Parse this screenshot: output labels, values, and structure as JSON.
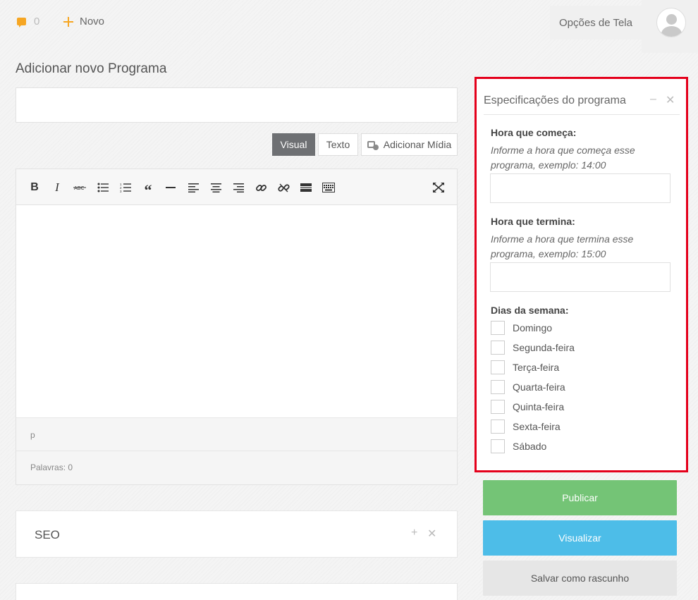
{
  "topbar": {
    "comment_count": "0",
    "new_label": "Novo",
    "screen_options_label": "Opções de Tela"
  },
  "page": {
    "title": "Adicionar novo Programa"
  },
  "editor": {
    "tab_visual": "Visual",
    "tab_text": "Texto",
    "add_media_label": "Adicionar Mídia",
    "path_label": "p",
    "word_count_label": "Palavras: 0"
  },
  "seo": {
    "title": "SEO"
  },
  "spec": {
    "title": "Especificações do programa",
    "start_label": "Hora que começa:",
    "start_help": "Informe a hora que começa esse programa, exemplo: 14:00",
    "end_label": "Hora que termina:",
    "end_help": "Informe a hora que termina esse programa, exemplo: 15:00",
    "days_label": "Dias da semana:",
    "days": [
      "Domingo",
      "Segunda-feira",
      "Terça-feira",
      "Quarta-feira",
      "Quinta-feira",
      "Sexta-feira",
      "Sábado"
    ]
  },
  "actions": {
    "publish": "Publicar",
    "preview": "Visualizar",
    "save_draft": "Salvar como rascunho"
  },
  "colors": {
    "accent": "#f6a623",
    "highlight_border": "#e4001b",
    "publish": "#74c476",
    "preview": "#4dbde8"
  }
}
